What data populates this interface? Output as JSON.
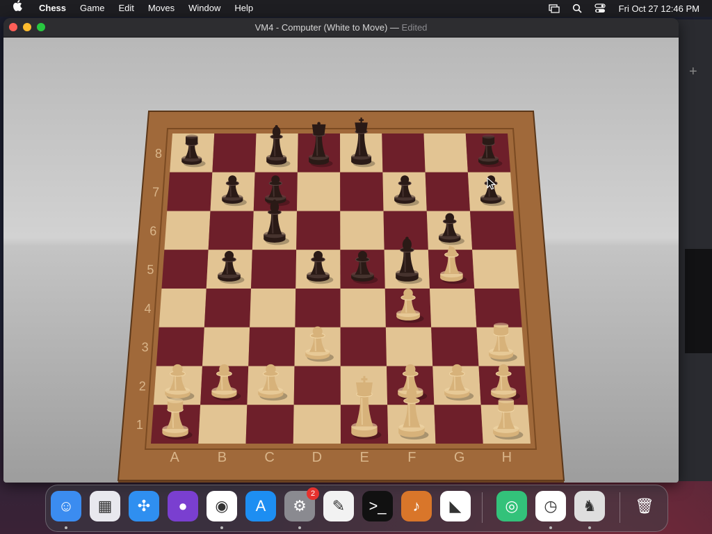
{
  "menubar": {
    "app_name": "Chess",
    "items": [
      "Game",
      "Edit",
      "Moves",
      "Window",
      "Help"
    ],
    "clock": "Fri Oct 27  12:46 PM"
  },
  "window": {
    "title": "VM4 - Computer   (White to Move)",
    "title_separator": "—",
    "title_status": "Edited"
  },
  "board": {
    "files": [
      "A",
      "B",
      "C",
      "D",
      "E",
      "F",
      "G",
      "H"
    ],
    "ranks": [
      "8",
      "7",
      "6",
      "5",
      "4",
      "3",
      "2",
      "1"
    ],
    "pieces": [
      {
        "square": "a8",
        "color": "black",
        "type": "rook"
      },
      {
        "square": "c8",
        "color": "black",
        "type": "bishop"
      },
      {
        "square": "d8",
        "color": "black",
        "type": "queen"
      },
      {
        "square": "e8",
        "color": "black",
        "type": "king"
      },
      {
        "square": "h8",
        "color": "black",
        "type": "rook"
      },
      {
        "square": "b7",
        "color": "black",
        "type": "pawn"
      },
      {
        "square": "c7",
        "color": "black",
        "type": "pawn"
      },
      {
        "square": "f7",
        "color": "black",
        "type": "pawn"
      },
      {
        "square": "h7",
        "color": "black",
        "type": "pawn"
      },
      {
        "square": "c6",
        "color": "black",
        "type": "bishop"
      },
      {
        "square": "g6",
        "color": "black",
        "type": "pawn"
      },
      {
        "square": "b5",
        "color": "black",
        "type": "pawn"
      },
      {
        "square": "d5",
        "color": "black",
        "type": "pawn"
      },
      {
        "square": "e5",
        "color": "black",
        "type": "pawn"
      },
      {
        "square": "f5",
        "color": "black",
        "type": "bishop"
      },
      {
        "square": "g5",
        "color": "white",
        "type": "knight"
      },
      {
        "square": "f4",
        "color": "white",
        "type": "pawn"
      },
      {
        "square": "d3",
        "color": "white",
        "type": "pawn"
      },
      {
        "square": "h3",
        "color": "white",
        "type": "rook"
      },
      {
        "square": "a2",
        "color": "white",
        "type": "pawn"
      },
      {
        "square": "b2",
        "color": "white",
        "type": "pawn"
      },
      {
        "square": "c2",
        "color": "white",
        "type": "pawn"
      },
      {
        "square": "f2",
        "color": "white",
        "type": "pawn"
      },
      {
        "square": "g2",
        "color": "white",
        "type": "pawn"
      },
      {
        "square": "h2",
        "color": "white",
        "type": "pawn"
      },
      {
        "square": "a1",
        "color": "white",
        "type": "rook"
      },
      {
        "square": "e1",
        "color": "white",
        "type": "king"
      },
      {
        "square": "f1",
        "color": "white",
        "type": "bishop"
      },
      {
        "square": "h1",
        "color": "white",
        "type": "rook"
      }
    ]
  },
  "colors": {
    "light_square": "#e2c493",
    "dark_square": "#6e1f2a",
    "frame": "#a0693a",
    "black_piece": "#2a1a16",
    "white_piece": "#d7b27a"
  },
  "dock": {
    "icons": [
      {
        "name": "finder-icon",
        "glyph": "☺",
        "bg": "#3b8cf0",
        "running": true
      },
      {
        "name": "launchpad-icon",
        "glyph": "▦",
        "bg": "#e8e8ee",
        "running": false
      },
      {
        "name": "safari-icon",
        "glyph": "✣",
        "bg": "#2f8ff0",
        "running": false
      },
      {
        "name": "firefox-icon",
        "glyph": "●",
        "bg": "#7a3fd0",
        "running": false
      },
      {
        "name": "chrome-icon",
        "glyph": "◉",
        "bg": "#ffffff",
        "running": true
      },
      {
        "name": "app-store-icon",
        "glyph": "A",
        "bg": "#1d8ef2",
        "running": false
      },
      {
        "name": "system-settings-icon",
        "glyph": "⚙",
        "bg": "#8a8a90",
        "running": true,
        "badge": "2"
      },
      {
        "name": "textedit-icon",
        "glyph": "✎",
        "bg": "#f2f2f2",
        "running": false
      },
      {
        "name": "terminal-icon",
        "glyph": ">_",
        "bg": "#111111",
        "running": false
      },
      {
        "name": "garageband-icon",
        "glyph": "♪",
        "bg": "#d9762a",
        "running": false
      },
      {
        "name": "vscode-icon",
        "glyph": "◣",
        "bg": "#ffffff",
        "running": false
      },
      {
        "name": "find-my-icon",
        "glyph": "◎",
        "bg": "#33c27a",
        "running": false
      },
      {
        "name": "clock-icon",
        "glyph": "◷",
        "bg": "#ffffff",
        "running": true
      },
      {
        "name": "chess-app-icon",
        "glyph": "♞",
        "bg": "#dedede",
        "running": true
      },
      {
        "name": "trash-icon",
        "glyph": "🗑",
        "bg": "transparent",
        "running": false
      }
    ]
  }
}
